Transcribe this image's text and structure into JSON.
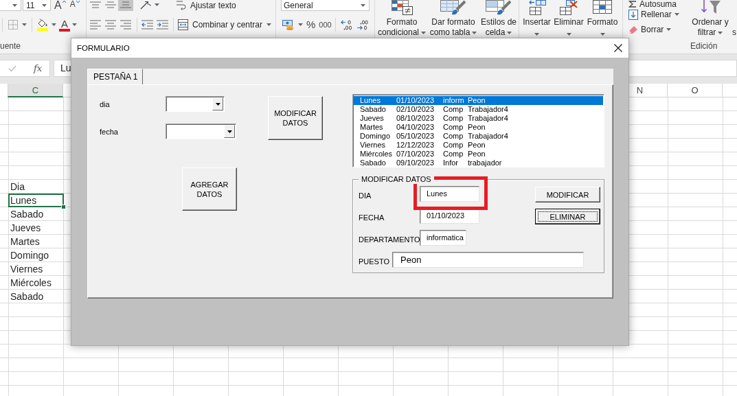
{
  "ribbon": {
    "font": {
      "size": "11",
      "grow": "A",
      "shrink": "A",
      "font_color": "A",
      "group_label": "uente"
    },
    "alignment": {
      "vertical_align": [
        {
          "selected": false
        },
        {
          "selected": false
        },
        {
          "selected": true
        }
      ],
      "wrap_text": "Ajustar texto",
      "merge": "Combinar y centrar"
    },
    "number": {
      "format": "General",
      "percent": "%",
      "thousands": "000"
    },
    "styles": [
      {
        "label": "Formato condicional"
      },
      {
        "label": "Dar formato como tabla"
      },
      {
        "label": "Estilos de celda"
      }
    ],
    "cells": [
      {
        "label": "Insertar"
      },
      {
        "label": "Eliminar"
      },
      {
        "label": "Formato"
      }
    ],
    "editing": {
      "autosum": "Autosuma",
      "fill": "Rellenar",
      "clear": "Borrar",
      "sort_filter": "Ordenar y filtrar",
      "cut_button": "s",
      "group_label": "Edición"
    }
  },
  "formula_bar": {
    "function_button": "fx",
    "value": "Lu"
  },
  "sheet": {
    "column_headers": [
      {
        "label": "C",
        "selected": true
      },
      {
        "label": "N",
        "selected": false
      },
      {
        "label": "O",
        "selected": false
      }
    ],
    "cells": [
      {
        "text": "Dia",
        "selected": false
      },
      {
        "text": "Lunes",
        "selected": true
      },
      {
        "text": "Sabado",
        "selected": false
      },
      {
        "text": "Jueves",
        "selected": false
      },
      {
        "text": "Martes",
        "selected": false
      },
      {
        "text": "Domingo",
        "selected": false
      },
      {
        "text": "Viernes",
        "selected": false
      },
      {
        "text": "Miércoles",
        "selected": false
      },
      {
        "text": "Sabado",
        "selected": false
      }
    ]
  },
  "dialog": {
    "title": "FORMULARIO",
    "tabs": [
      {
        "label": "PESTAÑA 1",
        "selected": true
      }
    ],
    "filters": [
      {
        "label": "dia"
      },
      {
        "label": "fecha"
      }
    ],
    "modify_data_button": "MODIFICAR DATOS",
    "add_data_button": "AGREGAR DATOS",
    "list": [
      {
        "cells": [
          "Lunes",
          "01/10/2023",
          "inform",
          "Peon"
        ],
        "selected": true
      },
      {
        "cells": [
          "Sabado",
          "02/10/2023",
          "Comp",
          "Trabajador4"
        ],
        "selected": false
      },
      {
        "cells": [
          "Jueves",
          "08/10/2023",
          "Comp",
          "Trabajador4"
        ],
        "selected": false
      },
      {
        "cells": [
          "Martes",
          "04/10/2023",
          "Comp",
          "Peon"
        ],
        "selected": false
      },
      {
        "cells": [
          "Domingo",
          "05/10/2023",
          "Comp",
          "Trabajador4"
        ],
        "selected": false
      },
      {
        "cells": [
          "Viernes",
          "12/12/2023",
          "Comp",
          "Peon"
        ],
        "selected": false
      },
      {
        "cells": [
          "Miércoles",
          "07/10/2023",
          "Comp",
          "Peon"
        ],
        "selected": false
      },
      {
        "cells": [
          "Sabado",
          "09/10/2023",
          "Infor",
          "trabajador"
        ],
        "selected": false
      }
    ],
    "frame": {
      "caption": "MODIFICAR DATOS",
      "fields": [
        {
          "label": "DIA",
          "value": "Lunes",
          "highlighted": true
        },
        {
          "label": "FECHA",
          "value": "01/10/2023",
          "highlighted": false
        },
        {
          "label": "DEPARTAMENTO",
          "value": "informatica",
          "highlighted": false
        },
        {
          "label": "PUESTO",
          "value": "Peon",
          "highlighted": false
        }
      ],
      "buttons": [
        {
          "label": "MODIFICAR",
          "focused": false
        },
        {
          "label": "ELIMINAR",
          "focused": true
        }
      ]
    }
  }
}
